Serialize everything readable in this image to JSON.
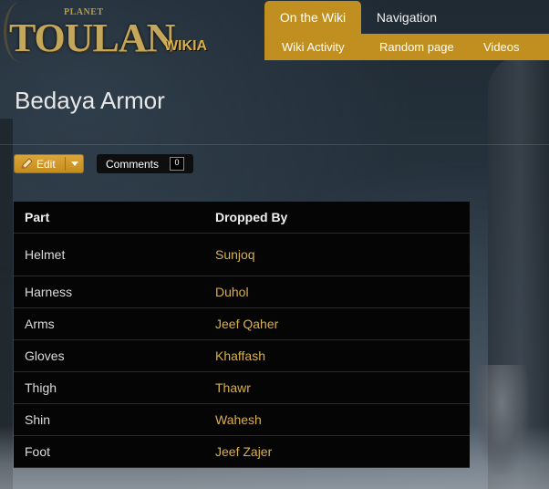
{
  "logo": {
    "planet": "PLANET",
    "name": "TOULAN",
    "wikia": "WIKIA"
  },
  "nav": {
    "tabs": [
      {
        "label": "On the Wiki",
        "active": true
      },
      {
        "label": "Navigation",
        "active": false
      }
    ],
    "sub_items": [
      "Wiki Activity",
      "Random page",
      "Videos"
    ]
  },
  "page": {
    "title": "Bedaya Armor"
  },
  "actions": {
    "edit_label": "Edit",
    "comments_label": "Comments",
    "comments_count": "0"
  },
  "table": {
    "headers": [
      "Part",
      "Dropped By"
    ],
    "rows": [
      {
        "part": "Helmet",
        "dropped_by": "Sunjoq"
      },
      {
        "part": "Harness",
        "dropped_by": "Duhol"
      },
      {
        "part": "Arms",
        "dropped_by": "Jeef Qaher"
      },
      {
        "part": "Gloves",
        "dropped_by": "Khaffash"
      },
      {
        "part": "Thigh",
        "dropped_by": "Thawr"
      },
      {
        "part": "Shin",
        "dropped_by": "Wahesh"
      },
      {
        "part": "Foot",
        "dropped_by": "Jeef Zajer"
      }
    ]
  },
  "colors": {
    "accent": "#c18f1f",
    "link": "#d9b04a",
    "table_bg": "#050505"
  }
}
